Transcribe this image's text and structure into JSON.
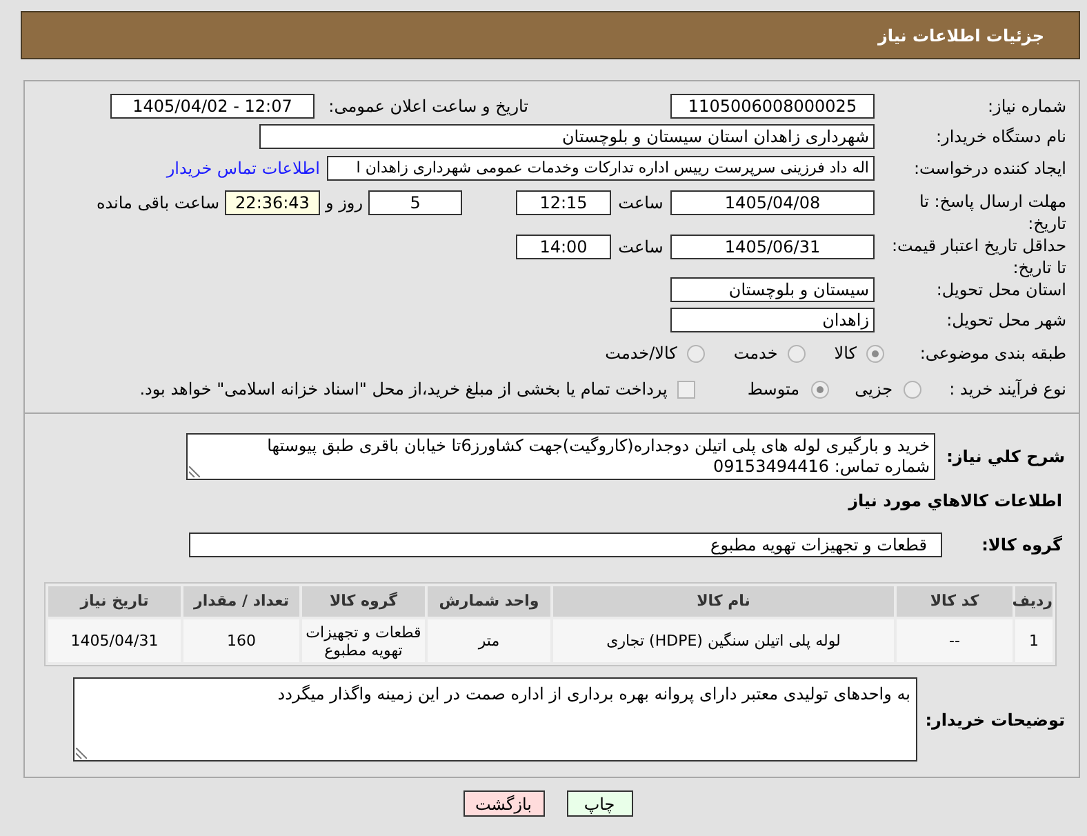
{
  "header": {
    "title": "جزئیات اطلاعات نیاز"
  },
  "need_number": {
    "label": "شماره نیاز:",
    "value": "1105006008000025"
  },
  "announcement": {
    "label": "تاریخ و ساعت اعلان عمومی:",
    "value": "1405/04/02 - 12:07"
  },
  "buyer_org": {
    "label": "نام دستگاه خریدار:",
    "value": "شهرداری زاهدان استان سیستان و بلوچستان"
  },
  "requester": {
    "label": "ایجاد کننده درخواست:",
    "value": "اله داد فرزینی سرپرست رییس اداره تدارکات وخدمات عمومی شهرداری زاهدان ا",
    "link": "اطلاعات تماس خریدار"
  },
  "reply_deadline": {
    "label": "مهلت ارسال پاسخ: تا تاریخ:",
    "date": "1405/04/08",
    "time_label": "ساعت",
    "time": "12:15",
    "days": "5",
    "days_label": "روز و",
    "remaining": "22:36:43",
    "remaining_label": "ساعت باقی مانده"
  },
  "price_validity": {
    "label": "حداقل تاریخ اعتبار قیمت: تا تاریخ:",
    "date": "1405/06/31",
    "time_label": "ساعت",
    "time": "14:00"
  },
  "delivery_province": {
    "label": "استان محل تحویل:",
    "value": "سیستان و بلوچستان"
  },
  "delivery_city": {
    "label": "شهر محل تحویل:",
    "value": "زاهدان"
  },
  "category": {
    "label": "طبقه بندی موضوعی:",
    "options": [
      {
        "label": "کالا",
        "selected": true
      },
      {
        "label": "خدمت",
        "selected": false
      },
      {
        "label": "کالا/خدمت",
        "selected": false
      }
    ]
  },
  "purchase_type": {
    "label": "نوع فرآیند خرید :",
    "options": [
      {
        "label": "جزیی",
        "selected": false
      },
      {
        "label": "متوسط",
        "selected": true
      }
    ],
    "treasury": {
      "label": "پرداخت تمام یا بخشی از مبلغ خرید،از محل \"اسناد خزانه اسلامی\" خواهد بود.",
      "checked": false
    }
  },
  "description": {
    "label": "شرح کلي نياز:",
    "value": "خرید و بارگیری لوله های پلی اتیلن دوجداره(کاروگیت)جهت کشاورز6تا خیابان باقری طبق پیوستها شماره تماس: 09153494416"
  },
  "goods_section": {
    "title": "اطلاعات کالاهاي مورد نياز"
  },
  "goods_group": {
    "label": "گروه کالا:",
    "value": "قطعات و تجهیزات تهویه مطبوع"
  },
  "goods_table": {
    "columns": [
      "ردیف",
      "کد کالا",
      "نام کالا",
      "واحد شمارش",
      "گروه کالا",
      "تعداد / مقدار",
      "تاریخ نیاز"
    ],
    "rows": [
      [
        "1",
        "--",
        "لوله پلی اتیلن سنگین (HDPE) تجاری",
        "متر",
        "قطعات و تجهیزات تهویه مطبوع",
        "160",
        "1405/04/31"
      ]
    ]
  },
  "buyer_notes": {
    "label": "توضیحات خریدار:",
    "value": "به واحدهای تولیدی معتبر دارای پروانه بهره برداری از اداره صمت در این زمینه واگذار میگردد"
  },
  "buttons": [
    {
      "kind": "print",
      "label": "چاپ"
    },
    {
      "kind": "back",
      "label": "بازگشت"
    }
  ]
}
